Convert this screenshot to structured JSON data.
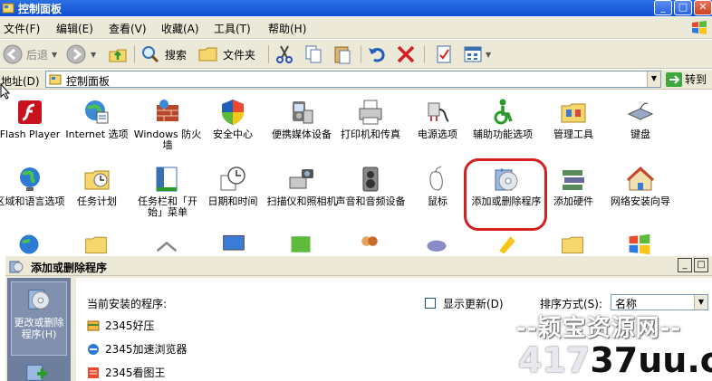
{
  "window": {
    "title": "控制面板",
    "buttons": [
      "_",
      "□",
      "✕"
    ]
  },
  "menu": [
    "文件(F)",
    "编辑(E)",
    "查看(V)",
    "收藏(A)",
    "工具(T)",
    "帮助(H)"
  ],
  "toolbar": {
    "back": "后退",
    "search": "搜索",
    "folders": "文件夹"
  },
  "address": {
    "label": "地址(D)",
    "value": "控制面板",
    "go": "转到"
  },
  "control_panel_items": [
    {
      "label": "Flash Player",
      "icon": "flash-icon"
    },
    {
      "label": "Internet 选项",
      "icon": "internet-options-icon"
    },
    {
      "label": "Windows 防火墙",
      "icon": "firewall-icon"
    },
    {
      "label": "安全中心",
      "icon": "security-center-icon"
    },
    {
      "label": "便携媒体设备",
      "icon": "portable-media-icon"
    },
    {
      "label": "打印机和传真",
      "icon": "printer-icon"
    },
    {
      "label": "电源选项",
      "icon": "power-icon"
    },
    {
      "label": "辅助功能选项",
      "icon": "accessibility-icon"
    },
    {
      "label": "管理工具",
      "icon": "admin-tools-icon"
    },
    {
      "label": "键盘",
      "icon": "keyboard-icon"
    },
    {
      "label": "区域和语言选项",
      "icon": "globe-icon"
    },
    {
      "label": "任务计划",
      "icon": "scheduled-tasks-icon"
    },
    {
      "label": "任务栏和「开始」菜单",
      "icon": "taskbar-icon"
    },
    {
      "label": "日期和时间",
      "icon": "clock-icon"
    },
    {
      "label": "扫描仪和照相机",
      "icon": "scanner-icon"
    },
    {
      "label": "声音和音频设备",
      "icon": "speaker-icon"
    },
    {
      "label": "鼠标",
      "icon": "mouse-icon"
    },
    {
      "label": "添加或删除程序",
      "icon": "add-remove-programs-icon"
    },
    {
      "label": "添加硬件",
      "icon": "add-hardware-icon"
    },
    {
      "label": "网络安装向导",
      "icon": "network-wizard-icon"
    }
  ],
  "dialog": {
    "title": "添加或删除程序",
    "left_item": "更改或删除程序(H)",
    "current_label": "当前安装的程序:",
    "show_updates": "显示更新(D)",
    "sort_label": "排序方式(S):",
    "sort_value": "名称",
    "programs": [
      "2345好压",
      "2345加速浏览器",
      "2345看图王"
    ]
  },
  "watermark": {
    "line1": "--颖宝资源网--",
    "line2_prefix": "417",
    "line2_main": "37uu.cn"
  },
  "colors": {
    "titlebar": "#0f4fd0",
    "highlight": "#d42020",
    "chrome": "#ece9d8"
  }
}
